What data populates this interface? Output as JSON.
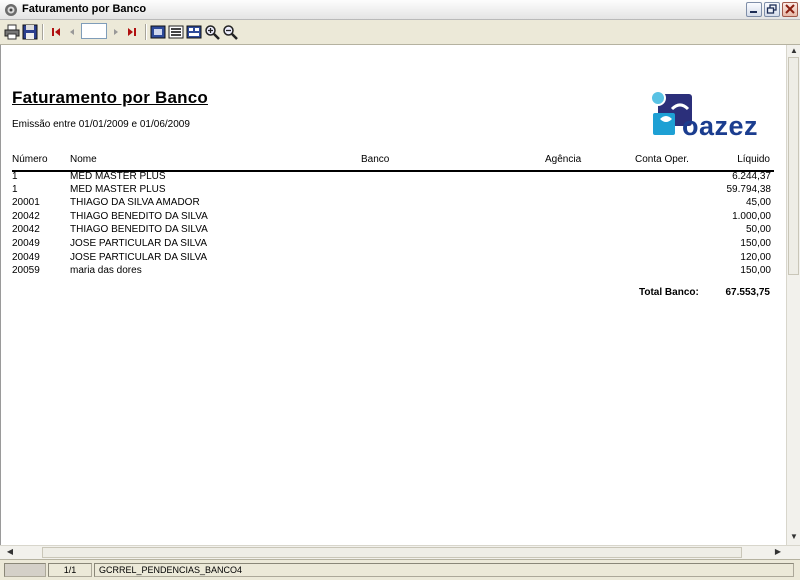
{
  "window": {
    "title": "Faturamento por Banco"
  },
  "toolbar": {
    "page_value": "",
    "icons": [
      "printer-icon",
      "save-icon",
      "first-page-icon",
      "previous-page-icon",
      "next-page-icon",
      "last-page-icon",
      "page-view-icon",
      "multi-page-icon",
      "zoom-fit-icon",
      "zoom-in-icon",
      "zoom-out-icon"
    ]
  },
  "report": {
    "title": "Faturamento por Banco",
    "subtitle": "Emissão entre 01/01/2009 e 01/06/2009",
    "logo_text": "oazez",
    "logo_color": "#1b3d8f",
    "columns": {
      "numero": "Número",
      "nome": "Nome",
      "banco": "Banco",
      "agencia": "Agência",
      "conta": "Conta Oper.",
      "liquido": "Líquido"
    },
    "rows": [
      {
        "numero": "1",
        "nome": "MED MASTER PLUS",
        "liquido": "6.244,37"
      },
      {
        "numero": "1",
        "nome": "MED MASTER PLUS",
        "liquido": "59.794,38"
      },
      {
        "numero": "20001",
        "nome": "THIAGO DA SILVA AMADOR",
        "liquido": "45,00"
      },
      {
        "numero": "20042",
        "nome": "THIAGO BENEDITO DA SILVA",
        "liquido": "1.000,00"
      },
      {
        "numero": "20042",
        "nome": "THIAGO BENEDITO DA SILVA",
        "liquido": "50,00"
      },
      {
        "numero": "20049",
        "nome": "JOSE PARTICULAR DA SILVA",
        "liquido": "150,00"
      },
      {
        "numero": "20049",
        "nome": "JOSE PARTICULAR DA SILVA",
        "liquido": "120,00"
      },
      {
        "numero": "20059",
        "nome": "maria das dores",
        "liquido": "150,00"
      }
    ],
    "total_label": "Total Banco:",
    "total_value": "67.553,75"
  },
  "statusbar": {
    "page_count": "1/1",
    "report_name": "GCRREL_PENDENCIAS_BANCO4"
  }
}
